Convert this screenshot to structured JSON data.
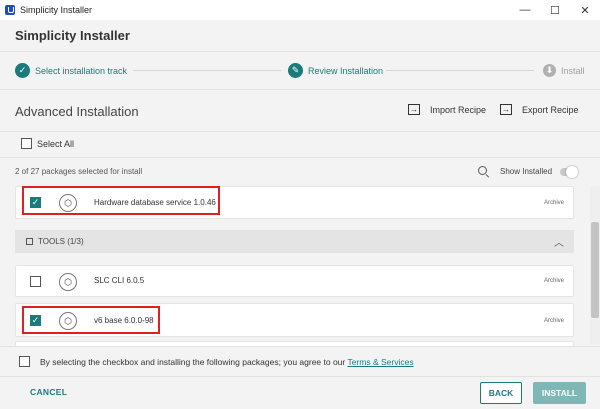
{
  "window": {
    "title": "Simplicity Installer",
    "controls": {
      "minimize": "—",
      "maximize": "☐",
      "close": "✕"
    }
  },
  "header": {
    "title": "Simplicity Installer"
  },
  "stepper": {
    "steps": [
      {
        "label": "Select installation track",
        "state": "done",
        "icon": "check-icon"
      },
      {
        "label": "Review Installation",
        "state": "active",
        "icon": "pencil-icon"
      },
      {
        "label": "Install",
        "state": "pending",
        "icon": "download-icon"
      }
    ]
  },
  "advanced": {
    "title": "Advanced Installation",
    "import_label": "Import Recipe",
    "export_label": "Export Recipe"
  },
  "select_all": {
    "label": "Select All",
    "checked": false
  },
  "summary": {
    "count_text": "2 of 27 packages selected for install",
    "show_installed_label": "Show Installed",
    "show_installed_on": false
  },
  "packages": [
    {
      "name": "Hardware database service 1.0.46",
      "tag": "Archive",
      "checked": true
    },
    {
      "name": "SLC CLI 6.0.5",
      "tag": "Archive",
      "checked": false
    },
    {
      "name": "v6 base 6.0.0-98",
      "tag": "Archive",
      "checked": true
    }
  ],
  "groups": [
    {
      "label": "TOOLS (1/3)",
      "expanded": true
    }
  ],
  "agreement": {
    "text": "By selecting the checkbox and installing the following packages; you agree to our ",
    "link": "Terms & Services"
  },
  "footer": {
    "cancel": "CANCEL",
    "back": "BACK",
    "install": "INSTALL"
  },
  "colors": {
    "accent": "#1b7a7a",
    "install_disabled": "#7fb7b7",
    "highlight": "#e02020"
  }
}
